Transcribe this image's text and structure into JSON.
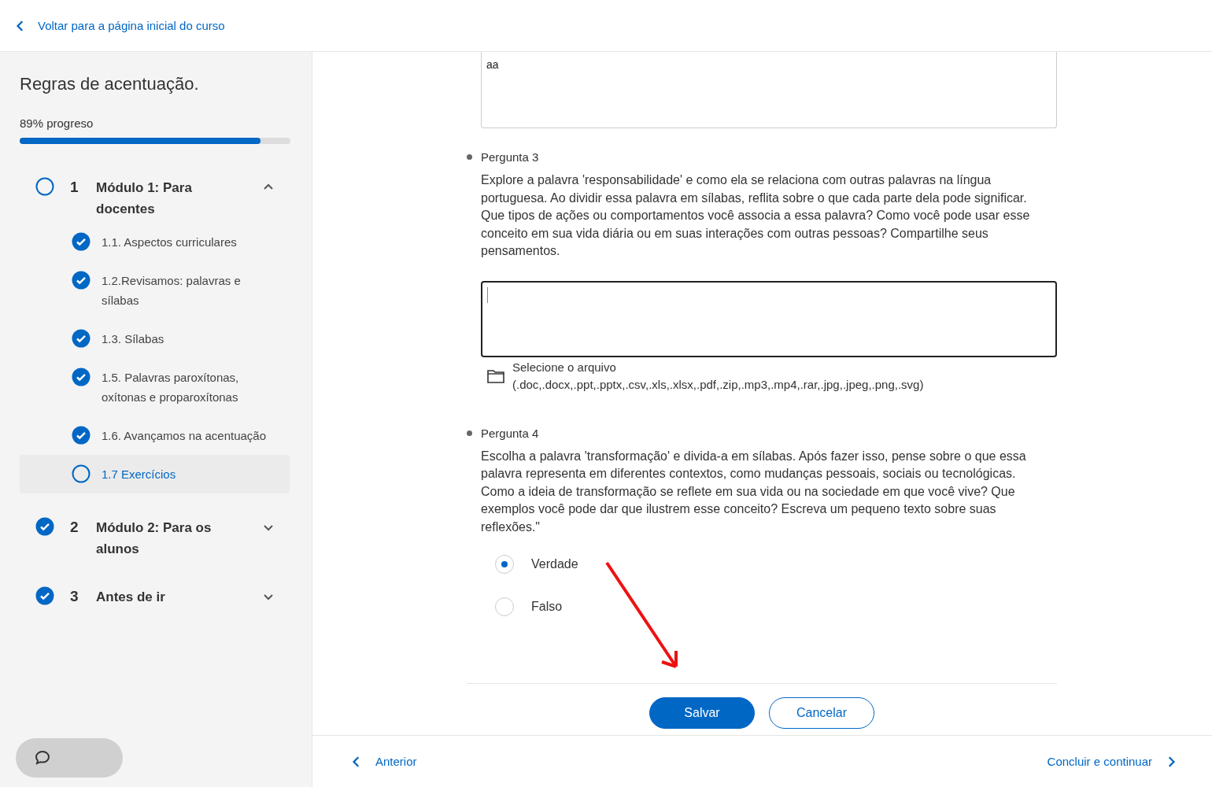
{
  "back_link": "Voltar para a página inicial do curso",
  "course": {
    "title": "Regras de acentuação.",
    "progress_label": "89% progreso",
    "level": 0.89
  },
  "modules": [
    {
      "number": "1",
      "title": "Módulo 1: Para docentes",
      "done": false,
      "expanded": true,
      "lessons": [
        {
          "title": "1.1. Aspectos curriculares",
          "done": true,
          "selected": false
        },
        {
          "title": "1.2.Revisamos: palavras e sílabas",
          "done": true,
          "selected": false
        },
        {
          "title": "1.3. Sílabas",
          "done": true,
          "selected": false
        },
        {
          "title": "1.5. Palavras paroxítonas, oxítonas e proparoxítonas",
          "done": true,
          "selected": false
        },
        {
          "title": "1.6. Avançamos na acentuação",
          "done": true,
          "selected": false
        },
        {
          "title": "1.7 Exercícios",
          "done": false,
          "selected": true
        }
      ]
    },
    {
      "number": "2",
      "title": "Módulo 2: Para os alunos",
      "done": true,
      "expanded": false
    },
    {
      "number": "3",
      "title": "Antes de ir",
      "done": true,
      "expanded": false
    }
  ],
  "previous_answer": {
    "value": "aa"
  },
  "questions": [
    {
      "kind": "text",
      "label": "Pergunta 3",
      "text": "Explore a palavra 'responsabilidade' e como ela se relaciona com outras palavras na língua portuguesa. Ao dividir essa palavra em sílabas, reflita sobre o que cada parte dela pode significar. Que tipos de ações ou comportamentos você associa a essa palavra? Como você pode usar esse conceito em sua vida diária ou em suas interações com outras pessoas? Compartilhe seus pensamentos.",
      "file_label": "Selecione o arquivo",
      "file_types": "(.doc,.docx,.ppt,.pptx,.csv,.xls,.xlsx,.pdf,.zip,.mp3,.mp4,.rar,.jpg,.jpeg,.png,.svg)"
    },
    {
      "kind": "choice",
      "label": "Pergunta 4",
      "text": "Escolha a palavra 'transformação' e divida-a em sílabas. Após fazer isso, pense sobre o que essa palavra representa em diferentes contextos, como mudanças pessoais, sociais ou tecnológicas. Como a ideia de transformação se reflete em sua vida ou na sociedade em que você vive? Que exemplos você pode dar que ilustrem esse conceito? Escreva um pequeno texto sobre suas reflexões.\"",
      "options": [
        {
          "label": "Verdade",
          "selected": true
        },
        {
          "label": "Falso",
          "selected": false
        }
      ]
    }
  ],
  "buttons": {
    "save": "Salvar",
    "cancel": "Cancelar"
  },
  "footer": {
    "previous": "Anterior",
    "next": "Concluir e continuar"
  }
}
